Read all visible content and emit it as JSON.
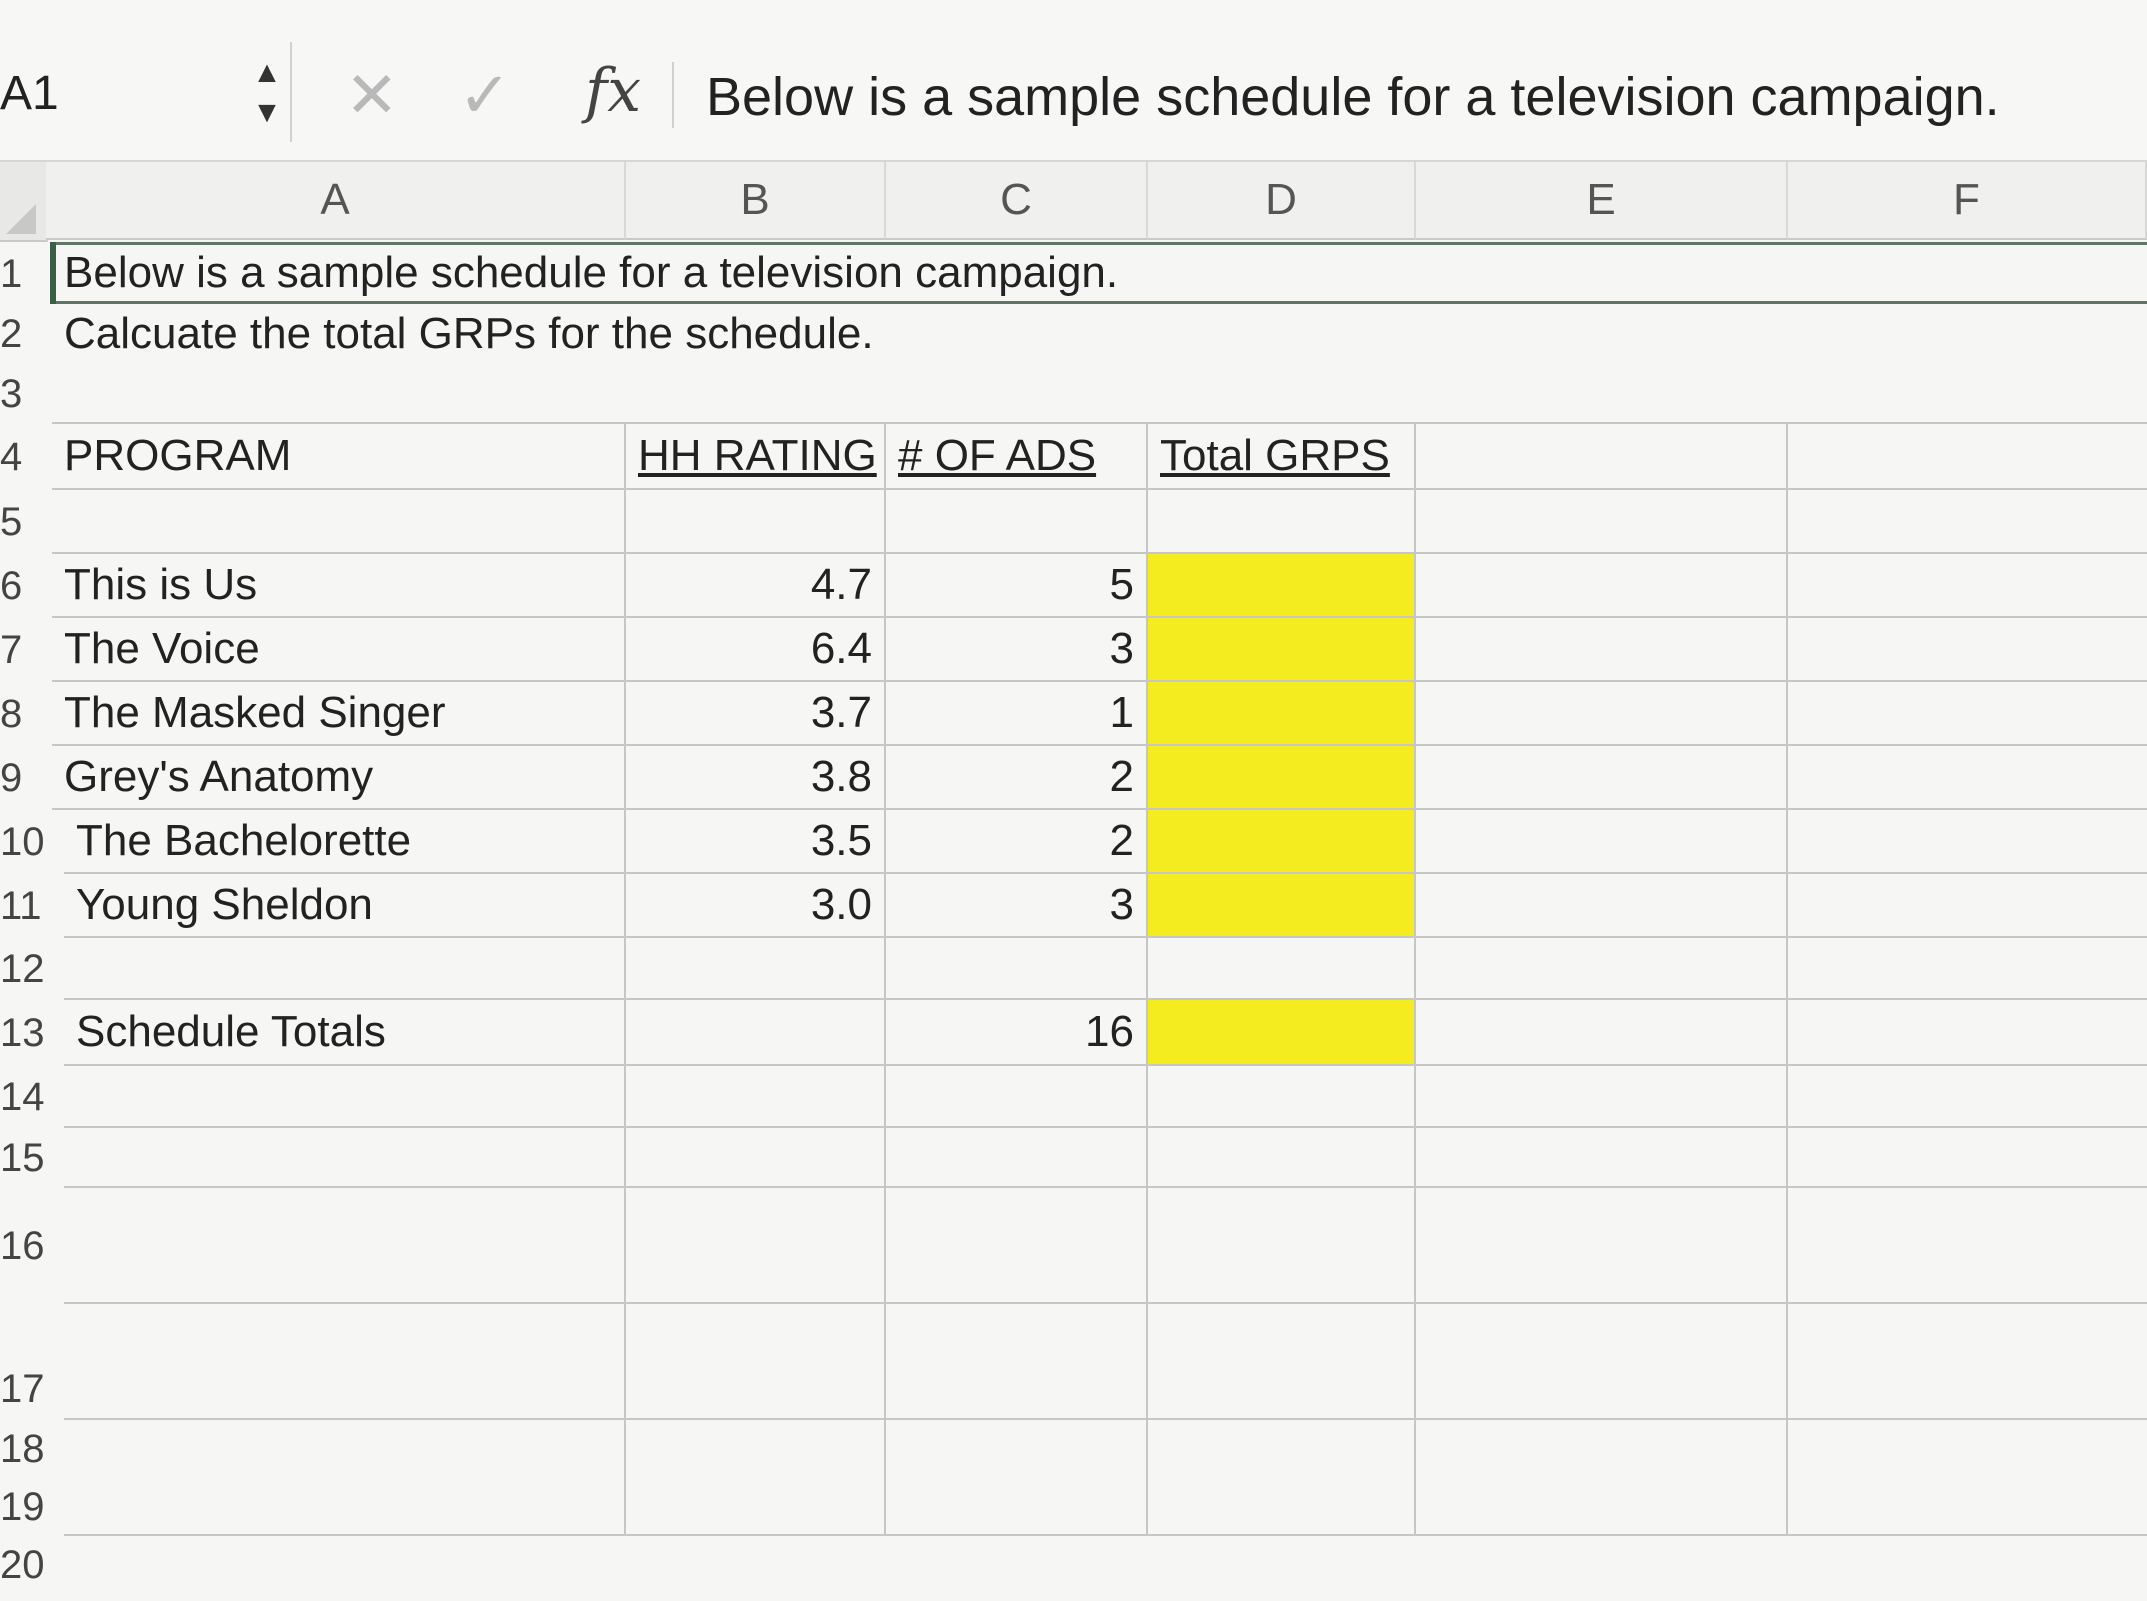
{
  "formula_bar": {
    "name_box": "A1",
    "cancel_icon": "close-icon",
    "enter_icon": "check-icon",
    "fx_label": "fx",
    "formula_text": "Below is a sample schedule for a television campaign."
  },
  "columns": [
    "A",
    "B",
    "C",
    "D",
    "E",
    "F"
  ],
  "rows": [
    "1",
    "2",
    "3",
    "4",
    "5",
    "6",
    "7",
    "8",
    "9",
    "10",
    "11",
    "12",
    "13",
    "14",
    "15",
    "16",
    "17",
    "18",
    "19",
    "20"
  ],
  "sheet": {
    "a1": "Below is a sample schedule for a television campaign.",
    "a2": "Calcuate the total GRPs for the schedule.",
    "headers": {
      "program": "PROGRAM",
      "hh_rating": "HH RATING",
      "num_ads": "# OF ADS",
      "total_grps": "Total GRPS"
    },
    "programs": [
      {
        "name": "This is Us",
        "rating": "4.7",
        "ads": "5"
      },
      {
        "name": "The Voice",
        "rating": "6.4",
        "ads": "3"
      },
      {
        "name": "The Masked Singer",
        "rating": "3.7",
        "ads": "1"
      },
      {
        "name": "Grey's Anatomy",
        "rating": "3.8",
        "ads": "2"
      },
      {
        "name": "The Bachelorette",
        "rating": "3.5",
        "ads": "2"
      },
      {
        "name": "Young Sheldon",
        "rating": "3.0",
        "ads": "3"
      }
    ],
    "totals": {
      "label": "Schedule Totals",
      "ads": "16"
    }
  },
  "colors": {
    "highlight": "#f4ec1f",
    "selection_border": "#5f7566"
  }
}
